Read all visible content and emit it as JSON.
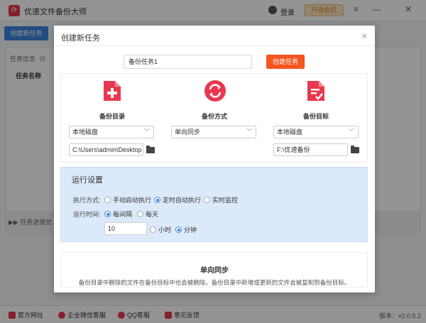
{
  "app": {
    "logo_glyph": "⟳",
    "title": "优速文件备份大师",
    "login_label": "登录",
    "vip_label": "开通会员",
    "menu_glyph": "≡",
    "minimize_glyph": "—",
    "close_glyph": "✕",
    "new_task_label": "创建新任务",
    "task_info_heading": "任务信息（0",
    "task_name_column": "任务名称",
    "progress_heading": "▶▶ 任务进度信",
    "footer": {
      "website": "官方网址",
      "wechat": "企业微信客服",
      "qq": "QQ客服",
      "feedback": "意见反馈",
      "version": "版本：v2.0.5.2"
    }
  },
  "dialog": {
    "title": "创建新任务",
    "close_glyph": "×",
    "task_name_value": "备份任务1",
    "create_button": "创建任务",
    "columns": {
      "source": {
        "label": "备份目录",
        "select_value": "本地磁盘",
        "path_value": "C:\\Users\\admin\\Desktop",
        "icon": "file-plus-icon"
      },
      "method": {
        "label": "备份方式",
        "select_value": "单向同步",
        "icon": "sync-icon"
      },
      "target": {
        "label": "备份目标",
        "select_value": "本地磁盘",
        "path_value": "F:\\优速备份",
        "icon": "file-check-icon"
      }
    },
    "run_settings": {
      "title": "运行设置",
      "mode_label": "执行方式:",
      "mode_options": [
        "手动启动执行",
        "定时自动执行",
        "实时监控"
      ],
      "mode_selected": "定时自动执行",
      "time_label": "运行时间:",
      "time_options": [
        "每间隔",
        "每天"
      ],
      "time_selected": "每间隔",
      "interval_value": "10",
      "unit_options": [
        "小时",
        "分钟"
      ],
      "unit_selected": "分钟"
    },
    "info": {
      "title": "单向同步",
      "description": "备份目录中删除的文件在备份目标中也会被删除，备份目录中新增或更新的文件会被复制到备份目标。"
    }
  },
  "colors": {
    "accent_red": "#e8384f",
    "create_orange": "#f4561f",
    "primary_blue": "#3c86dc",
    "run_panel_bg": "#dce9fa"
  }
}
